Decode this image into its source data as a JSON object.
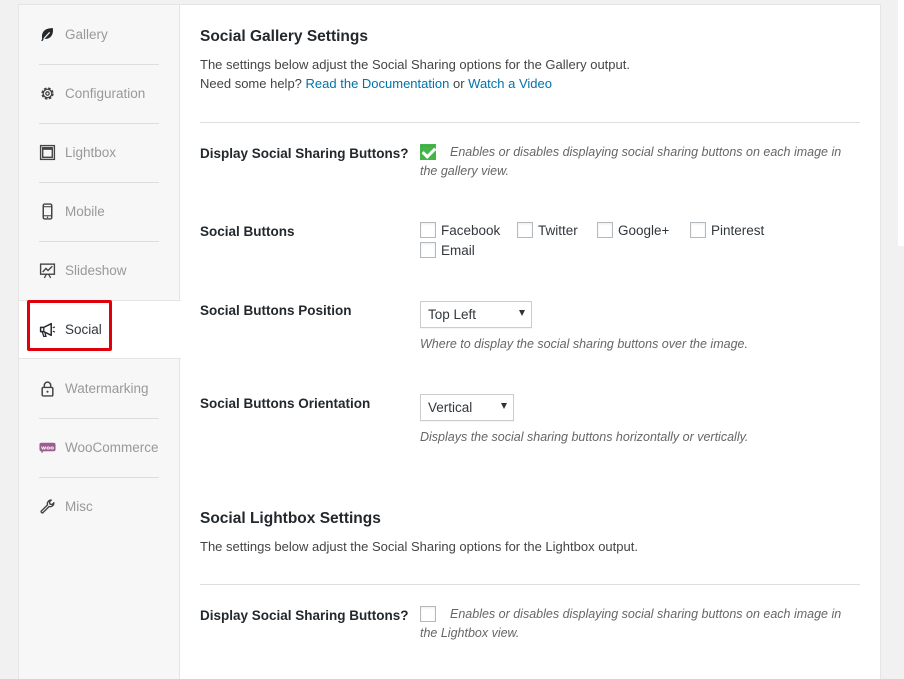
{
  "sidebar": {
    "items": [
      {
        "label": "Gallery",
        "icon": "leaf-icon"
      },
      {
        "label": "Configuration",
        "icon": "gear-icon"
      },
      {
        "label": "Lightbox",
        "icon": "lightbox-icon"
      },
      {
        "label": "Mobile",
        "icon": "mobile-icon"
      },
      {
        "label": "Slideshow",
        "icon": "slideshow-icon"
      },
      {
        "label": "Social",
        "icon": "megaphone-icon"
      },
      {
        "label": "Watermarking",
        "icon": "lock-icon"
      },
      {
        "label": "WooCommerce",
        "icon": "woocommerce-icon"
      },
      {
        "label": "Misc",
        "icon": "wrench-icon"
      }
    ],
    "active": "Social",
    "highlight_color": "#e0000c"
  },
  "gallery_section": {
    "title": "Social Gallery Settings",
    "description": "The settings below adjust the Social Sharing options for the Gallery output.",
    "help_prefix": "Need some help?",
    "doc_link": "Read the Documentation",
    "or_text": "or",
    "video_link": "Watch a Video",
    "display_label": "Display Social Sharing Buttons?",
    "display_checked": true,
    "display_help": "Enables or disables displaying social sharing buttons on each image in the gallery view.",
    "buttons_label": "Social Buttons",
    "buttons": [
      {
        "label": "Facebook",
        "checked": false
      },
      {
        "label": "Twitter",
        "checked": false
      },
      {
        "label": "Google+",
        "checked": false
      },
      {
        "label": "Pinterest",
        "checked": false
      },
      {
        "label": "Email",
        "checked": false
      }
    ],
    "position_label": "Social Buttons Position",
    "position_value": "Top Left",
    "position_help": "Where to display the social sharing buttons over the image.",
    "orientation_label": "Social Buttons Orientation",
    "orientation_value": "Vertical",
    "orientation_help": "Displays the social sharing buttons horizontally or vertically."
  },
  "lightbox_section": {
    "title": "Social Lightbox Settings",
    "description": "The settings below adjust the Social Sharing options for the Lightbox output.",
    "display_label": "Display Social Sharing Buttons?",
    "display_checked": false,
    "display_help": "Enables or disables displaying social sharing buttons on each image in the Lightbox view."
  },
  "colors": {
    "accent_link": "#0073aa",
    "checkbox_checked": "#45b649"
  }
}
